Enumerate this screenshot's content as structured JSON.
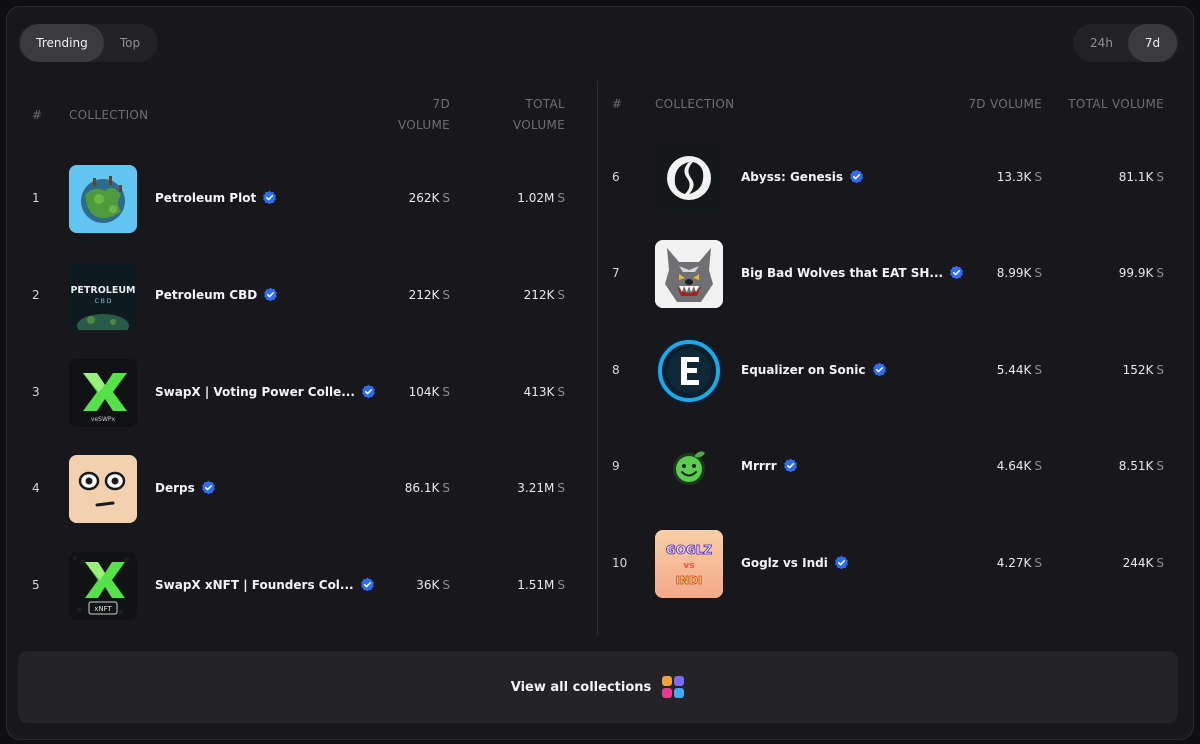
{
  "tabs": {
    "trending": "Trending",
    "top": "Top"
  },
  "periods": {
    "d1": "24h",
    "d7": "7d"
  },
  "headers": {
    "left": {
      "rank": "#",
      "collection": "COLLECTION",
      "vol7_a": "7D",
      "vol7_b": "VOLUME",
      "total_a": "TOTAL",
      "total_b": "VOLUME"
    },
    "right": {
      "rank": "#",
      "collection": "COLLECTION",
      "vol7": "7D VOLUME",
      "total": "TOTAL VOLUME"
    }
  },
  "unit": "S",
  "left_rows": [
    {
      "rank": "1",
      "name": "Petroleum Plot",
      "vol7": "262K",
      "total": "1.02M",
      "thumb": "planet-blue"
    },
    {
      "rank": "2",
      "name": "Petroleum CBD",
      "vol7": "212K",
      "total": "212K",
      "thumb": "petroleum-cbd"
    },
    {
      "rank": "3",
      "name": "SwapX | Voting Power Colle...",
      "vol7": "104K",
      "total": "413K",
      "thumb": "swapx-veswpx",
      "thumb_text": "veSWPx"
    },
    {
      "rank": "4",
      "name": "Derps",
      "vol7": "86.1K",
      "total": "3.21M",
      "thumb": "derp-face"
    },
    {
      "rank": "5",
      "name": "SwapX xNFT | Founders Col...",
      "vol7": "36K",
      "total": "1.51M",
      "thumb": "swapx-xnft",
      "thumb_text": "xNFT"
    }
  ],
  "right_rows": [
    {
      "rank": "6",
      "name": "Abyss: Genesis",
      "vol7": "13.3K",
      "total": "81.1K",
      "thumb": "abyss-swirl"
    },
    {
      "rank": "7",
      "name": "Big Bad Wolves that EAT SH...",
      "vol7": "8.99K",
      "total": "99.9K",
      "thumb": "wolf-head"
    },
    {
      "rank": "8",
      "name": "Equalizer on Sonic",
      "vol7": "5.44K",
      "total": "152K",
      "thumb": "equalizer-e"
    },
    {
      "rank": "9",
      "name": "Mrrrr",
      "vol7": "4.64K",
      "total": "8.51K",
      "thumb": "green-smiley"
    },
    {
      "rank": "10",
      "name": "Goglz vs Indi",
      "vol7": "4.27K",
      "total": "244K",
      "thumb": "goglz-logo",
      "thumb_text": "GOGLZ"
    }
  ],
  "thumb_text_cbd": "PETROLEUM",
  "thumb_text_cbd_sub": "C B D",
  "thumb_text_goglz_vs": "vs",
  "thumb_text_goglz_indi": "INDI",
  "cta": {
    "label": "View all collections",
    "icon": "grid-colorful-icon"
  },
  "colors": {
    "verify_blue": "#2e6cf0",
    "accent_green": "#56e04a",
    "equalizer_blue": "#1da8e8"
  }
}
